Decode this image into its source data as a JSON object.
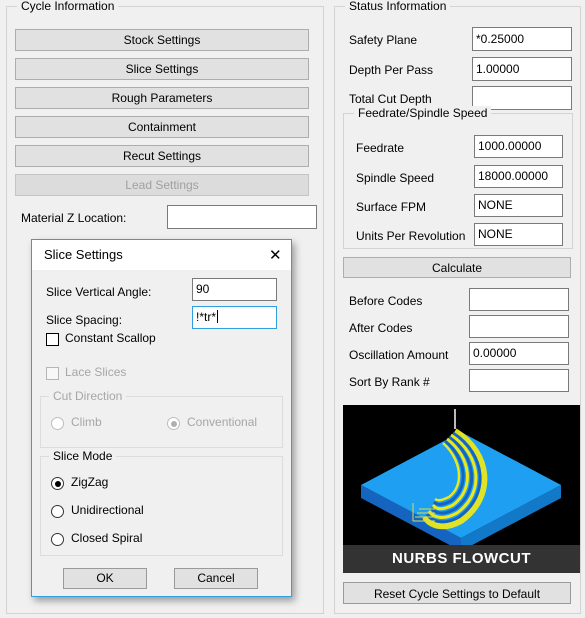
{
  "cycle_panel": {
    "title": "Cycle Information",
    "buttons": [
      {
        "label": "Stock Settings",
        "enabled": true
      },
      {
        "label": "Slice Settings",
        "enabled": true
      },
      {
        "label": "Rough Parameters",
        "enabled": true
      },
      {
        "label": "Containment",
        "enabled": true
      },
      {
        "label": "Recut Settings",
        "enabled": true
      },
      {
        "label": "Lead Settings",
        "enabled": false
      }
    ],
    "material_z_label": "Material Z Location:",
    "material_z_value": ""
  },
  "status_panel": {
    "title": "Status Information",
    "rows": [
      {
        "label": "Safety Plane",
        "value": "*0.25000"
      },
      {
        "label": "Depth Per Pass",
        "value": "1.00000"
      },
      {
        "label": "Total Cut Depth",
        "value": ""
      }
    ],
    "feed_group": {
      "title": "Feedrate/Spindle Speed",
      "rows": [
        {
          "label": "Feedrate",
          "value": "1000.00000"
        },
        {
          "label": "Spindle Speed",
          "value": "18000.00000"
        },
        {
          "label": "Surface FPM",
          "value": "NONE"
        },
        {
          "label": "Units Per Revolution",
          "value": "NONE"
        }
      ]
    },
    "calculate_label": "Calculate",
    "code_rows": [
      {
        "label": "Before Codes",
        "value": ""
      },
      {
        "label": "After Codes",
        "value": ""
      },
      {
        "label": "Oscillation Amount",
        "value": "0.00000"
      },
      {
        "label": "Sort By Rank #",
        "value": ""
      }
    ],
    "preview_caption": "NURBS FLOWCUT",
    "reset_label": "Reset Cycle Settings to Default"
  },
  "dialog": {
    "title": "Slice Settings",
    "close_glyph": "✕",
    "vertical_angle_label": "Slice Vertical Angle:",
    "vertical_angle_value": "90",
    "spacing_label": "Slice Spacing:",
    "spacing_value": "!*tr*",
    "constant_scallop_label": "Constant Scallop",
    "constant_scallop_checked": false,
    "lace_slices_label": "Lace Slices",
    "lace_slices_checked": false,
    "lace_slices_enabled": false,
    "cut_direction": {
      "title": "Cut Direction",
      "enabled": false,
      "options": [
        {
          "label": "Climb",
          "selected": false
        },
        {
          "label": "Conventional",
          "selected": true
        }
      ]
    },
    "slice_mode": {
      "title": "Slice Mode",
      "options": [
        {
          "label": "ZigZag",
          "selected": true
        },
        {
          "label": "Unidirectional",
          "selected": false
        },
        {
          "label": "Closed Spiral",
          "selected": false
        }
      ]
    },
    "ok_label": "OK",
    "cancel_label": "Cancel"
  },
  "colors": {
    "window_bg": "#f0f0f0",
    "button_face": "#e1e1e1",
    "dialog_accent": "#2f9fe0",
    "preview_bg": "#000000",
    "stock_blue": "#1e9ff2",
    "toolpath_yellow": "#ece81a"
  }
}
